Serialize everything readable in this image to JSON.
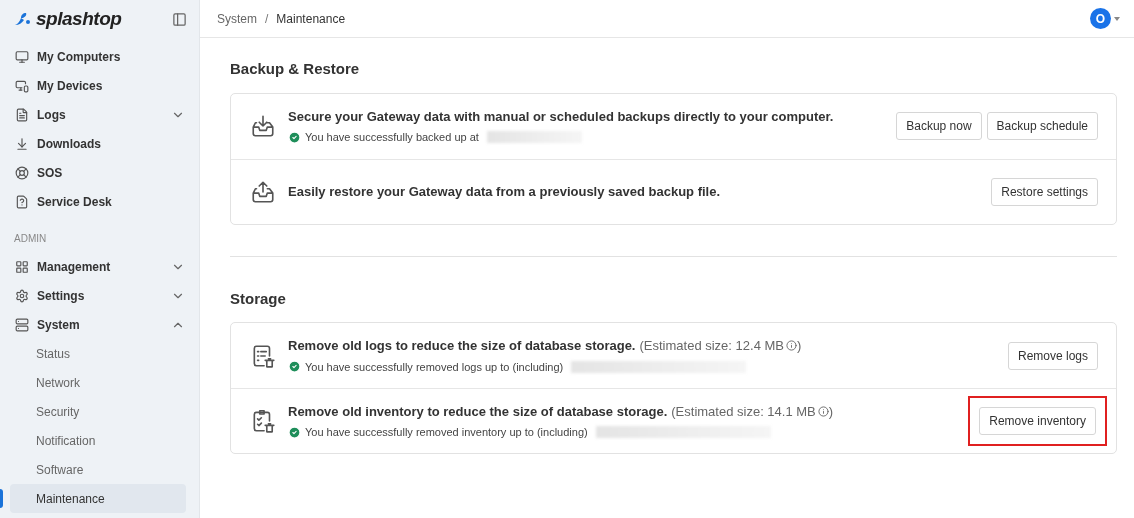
{
  "sidebar": {
    "logo": "splashtop",
    "items": [
      {
        "kind": "item",
        "label": "My Computers",
        "selected": false
      },
      {
        "kind": "item",
        "label": "My Devices",
        "selected": false
      },
      {
        "kind": "item",
        "label": "Logs",
        "selected": false,
        "expanded": false
      },
      {
        "kind": "item",
        "label": "Downloads",
        "selected": false
      },
      {
        "kind": "item",
        "label": "SOS",
        "selected": false
      },
      {
        "kind": "item",
        "label": "Service Desk",
        "selected": false
      },
      {
        "kind": "section",
        "label": "ADMIN"
      },
      {
        "kind": "item",
        "label": "Management",
        "selected": false,
        "expanded": false
      },
      {
        "kind": "item",
        "label": "Settings",
        "selected": false,
        "expanded": false
      },
      {
        "kind": "item",
        "label": "System",
        "selected": false,
        "expanded": true,
        "children": [
          {
            "label": "Status",
            "selected": false
          },
          {
            "label": "Network",
            "selected": false
          },
          {
            "label": "Security",
            "selected": false
          },
          {
            "label": "Notification",
            "selected": false
          },
          {
            "label": "Software",
            "selected": false
          },
          {
            "label": "Maintenance",
            "selected": true
          }
        ]
      }
    ]
  },
  "breadcrumb": {
    "items": [
      "System",
      "Maintenance"
    ],
    "separator": "/"
  },
  "avatar": "O",
  "sections": [
    {
      "title": "Backup & Restore",
      "rows": [
        {
          "text": "Secure your Gateway data with manual or scheduled backups directly to your computer.",
          "status": "You have successfully backed up at",
          "buttons": [
            {
              "label": "Backup now",
              "highlighted": false
            },
            {
              "label": "Backup schedule",
              "highlighted": false
            }
          ]
        },
        {
          "text": "Easily restore your Gateway data from a previously saved backup file.",
          "buttons": [
            {
              "label": "Restore settings",
              "highlighted": false
            }
          ]
        }
      ]
    },
    {
      "title": "Storage",
      "rows": [
        {
          "text": "Remove old logs to reduce the size of database storage.",
          "note": "(Estimated size: 12.4 MB",
          "note_end": ")",
          "status": "You have successfully removed logs up to (including)",
          "buttons": [
            {
              "label": "Remove logs",
              "highlighted": false
            }
          ]
        },
        {
          "text": "Remove old inventory to reduce the size of database storage.",
          "note": "(Estimated size: 14.1 MB",
          "note_end": ")",
          "status": "You have successfully removed inventory up to (including)",
          "buttons": [
            {
              "label": "Remove inventory",
              "highlighted": true
            }
          ]
        }
      ]
    }
  ]
}
